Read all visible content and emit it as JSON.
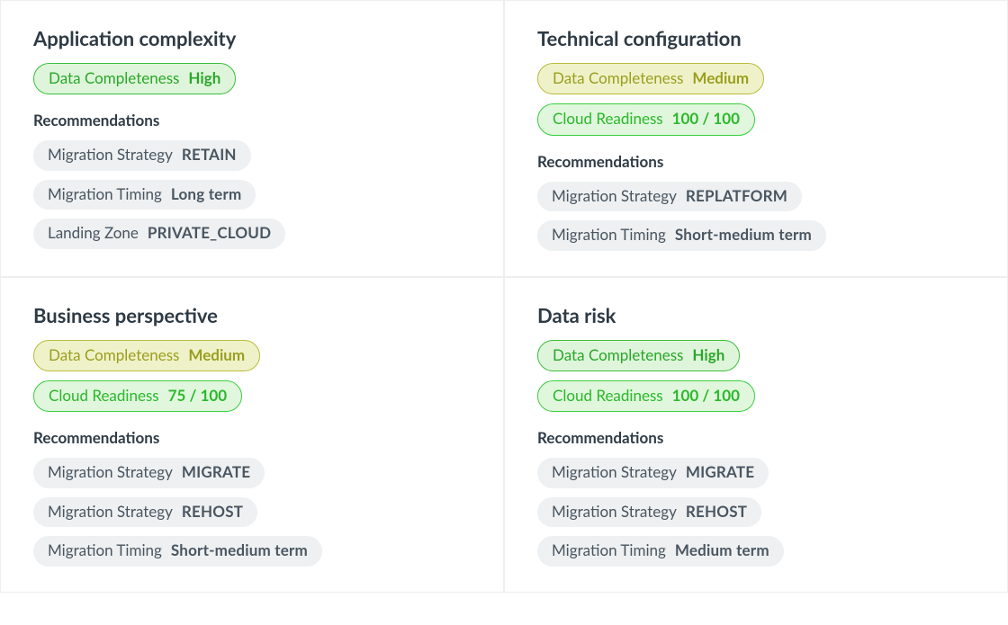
{
  "labels": {
    "data_completeness": "Data Completeness",
    "cloud_readiness": "Cloud Readiness",
    "recommendations": "Recommendations",
    "migration_strategy": "Migration Strategy",
    "migration_timing": "Migration Timing",
    "landing_zone": "Landing Zone"
  },
  "cards": {
    "app_complexity": {
      "title": "Application complexity",
      "data_completeness": "High",
      "recs": {
        "strategy": "RETAIN",
        "timing": "Long term",
        "landing_zone": "PRIVATE_CLOUD"
      }
    },
    "tech_config": {
      "title": "Technical configuration",
      "data_completeness": "Medium",
      "cloud_readiness": "100 / 100",
      "recs": {
        "strategy": "REPLATFORM",
        "timing": "Short-medium term"
      }
    },
    "biz_perspective": {
      "title": "Business perspective",
      "data_completeness": "Medium",
      "cloud_readiness": "75 / 100",
      "recs": {
        "strategy1": "MIGRATE",
        "strategy2": "REHOST",
        "timing": "Short-medium term"
      }
    },
    "data_risk": {
      "title": "Data risk",
      "data_completeness": "High",
      "cloud_readiness": "100 / 100",
      "recs": {
        "strategy1": "MIGRATE",
        "strategy2": "REHOST",
        "timing": "Medium term"
      }
    }
  }
}
